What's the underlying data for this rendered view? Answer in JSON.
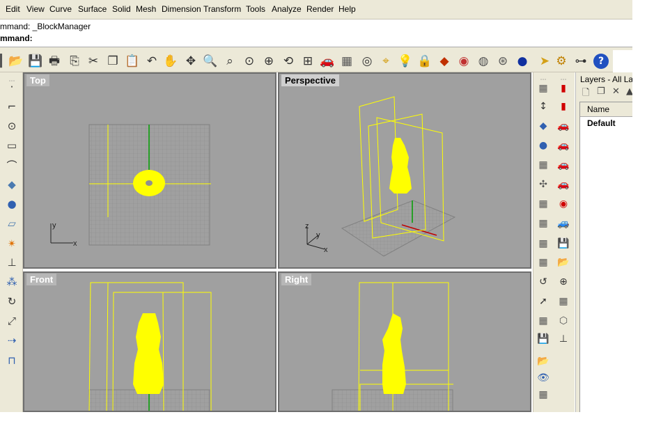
{
  "menu": [
    "Edit",
    "View",
    "Curve",
    "Surface",
    "Solid",
    "Mesh",
    "Dimension",
    "Transform",
    "Tools",
    "Analyze",
    "Render",
    "Help"
  ],
  "command": {
    "history": "mmand: _BlockManager",
    "prompt": "mmand:"
  },
  "toolbar_icons": [
    "open-icon",
    "save-icon",
    "print-icon",
    "import-icon",
    "cut-icon",
    "copy-icon",
    "paste-icon",
    "undo-icon",
    "pan-hand-icon",
    "rotate-view-icon",
    "zoom-dynamic-icon",
    "zoom-window-icon",
    "zoom-extents-icon",
    "zoom-selected-icon",
    "undo-view-icon",
    "four-viewports-icon",
    "car-icon",
    "grid-options-icon",
    "point-snap-icon",
    "object-snap-icon",
    "light-bulb-icon",
    "lock-icon",
    "layer-icon",
    "color-wheel-icon",
    "wireframe-sphere-icon",
    "shaded-sphere-icon",
    "rendered-sphere-icon",
    "select-cursor-icon",
    "gear-settings-icon",
    "hierarchy-icon",
    "help-icon"
  ],
  "viewports": {
    "top": {
      "label": "Top",
      "axis_x": "x",
      "axis_y": "y"
    },
    "perspective": {
      "label": "Perspective",
      "axis_x": "x",
      "axis_y": "y",
      "axis_z": "z"
    },
    "front": {
      "label": "Front"
    },
    "right": {
      "label": "Right"
    }
  },
  "layers": {
    "title": "Layers - All Laye",
    "column_name": "Name",
    "rows": [
      "Default"
    ]
  },
  "colors": {
    "chrome": "#ece9d8",
    "viewport_bg": "#a0a0a0",
    "grid": "#8c8c8c",
    "model": "#ffff00",
    "axis_green": "#00a000",
    "axis_red": "#c00000"
  }
}
